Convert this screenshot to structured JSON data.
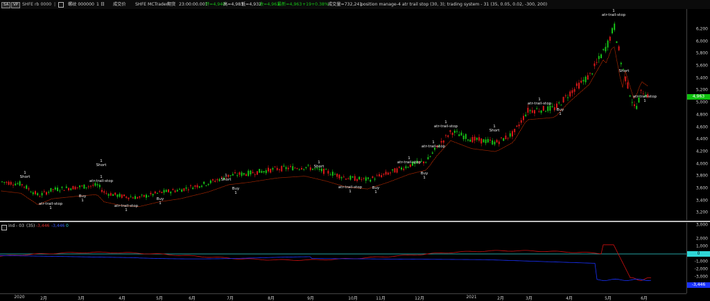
{
  "header": {
    "tag1": "SA",
    "tag2": "VP",
    "symbol": "SHFE rb 0000",
    "symbol_name": "螺纹 000000",
    "period": "1 日",
    "exchange": "成交价",
    "source": "SHFE",
    "provider": "MCTrader",
    "time_label": "期货",
    "time": "23:00:00.001",
    "open": "开=4,940",
    "high": "高=4,983",
    "low": "低=4,932",
    "close": "收=4,963",
    "last": "最新=4,963",
    "change": "+19",
    "change_pct": "+0.38%",
    "volume": "成交量=732,241",
    "studies": "position manage-4 atr trail stop (30, 3); trading system - 31 (35, 0.05, 0.02, -300, 200)"
  },
  "sub_header": {
    "name": "ind - 03",
    "params": "(35)",
    "value1": "-3,446",
    "value2": "-3,446",
    "value3": "0"
  },
  "price_axis": {
    "labels": [
      "6,200",
      "6,000",
      "5,800",
      "5,600",
      "5,400",
      "5,200",
      "5,000",
      "4,800",
      "4,600",
      "4,400",
      "4,200",
      "4,000",
      "3,800",
      "3,600",
      "3,400",
      "3,200",
      "3,000"
    ],
    "last_badge": "4,963"
  },
  "ind_axis": {
    "labels": [
      "2,000",
      "1,000",
      "0",
      "-1,000",
      "-2,000",
      "-3,000"
    ],
    "zero_badge": "0",
    "last_badge": "-3,446"
  },
  "time_axis": {
    "labels": [
      "2020",
      "2月",
      "3月",
      "4月",
      "5月",
      "6月",
      "7月",
      "8月",
      "9月",
      "10月",
      "11月",
      "12月",
      "2021",
      "2月",
      "3月",
      "4月",
      "5月",
      "6月"
    ]
  },
  "annotations": [
    {
      "text": "1\nShort",
      "cls": "short-1"
    },
    {
      "text": "atr-trail-stop\n1",
      "cls": "ats-1"
    },
    {
      "text": "1\nShort",
      "cls": "short-2"
    },
    {
      "text": "1\natr-trail-stop",
      "cls": "ats-2"
    },
    {
      "text": "Buy\n1",
      "cls": "buy-1"
    },
    {
      "text": "atr-trail-stop\n1",
      "cls": "ats-3"
    },
    {
      "text": "Buy\n1",
      "cls": "buy-2"
    },
    {
      "text": "1\nShort",
      "cls": "short-3"
    },
    {
      "text": "Buy\n1",
      "cls": "buy-3"
    },
    {
      "text": "1\nShort",
      "cls": "short-4"
    },
    {
      "text": "atr-trail-stop\n1",
      "cls": "ats-4"
    },
    {
      "text": "Buy\n1",
      "cls": "buy-4"
    },
    {
      "text": "1\natr-trail-stop",
      "cls": "ats-5"
    },
    {
      "text": "Buy\n1",
      "cls": "buy-5"
    },
    {
      "text": "1\natr-trail-stop",
      "cls": "ats-6"
    },
    {
      "text": "1\natr-trail-stop",
      "cls": "ats-7"
    },
    {
      "text": "1\nShort",
      "cls": "short-5"
    },
    {
      "text": "1\natr-trail-stop",
      "cls": "ats-8"
    },
    {
      "text": "Buy\n1",
      "cls": "buy-6"
    },
    {
      "text": "1\natr-trail-stop",
      "cls": "ats-9"
    },
    {
      "text": "Short",
      "cls": "short-6"
    },
    {
      "text": "atr-trail-stop\n1",
      "cls": "ats-10"
    }
  ],
  "colors": {
    "up": "#17c217",
    "down": "#d81818",
    "trail": "#ff3a00",
    "ind_red": "#d01010",
    "ind_blue": "#1a32ff",
    "zero_line": "#2fd6d6",
    "badge_green": "#10c010",
    "badge_blue": "#1a32ff"
  }
}
